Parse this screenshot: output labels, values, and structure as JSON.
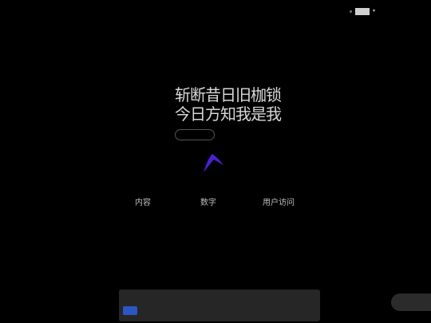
{
  "nav": {
    "logo": "",
    "brand": "",
    "items": [
      {
        "label": ""
      },
      {
        "label": ""
      },
      {
        "label": ""
      }
    ],
    "lang": ""
  },
  "hero": {
    "kicker": "",
    "line1": "斩断昔日旧枷锁",
    "line2": "今日方知我是我",
    "button": ""
  },
  "stats": [
    {
      "value": "内容",
      "unit": "",
      "label": ""
    },
    {
      "value": "数字",
      "unit": "",
      "label": ""
    },
    {
      "value": "用户访问",
      "unit": "",
      "label": ""
    }
  ],
  "section": {
    "title": "",
    "count": "",
    "placeholder": ""
  },
  "chat": {
    "label": ""
  },
  "colors": {
    "accent": "#4b1fd6",
    "submit": "#2a56c6"
  }
}
